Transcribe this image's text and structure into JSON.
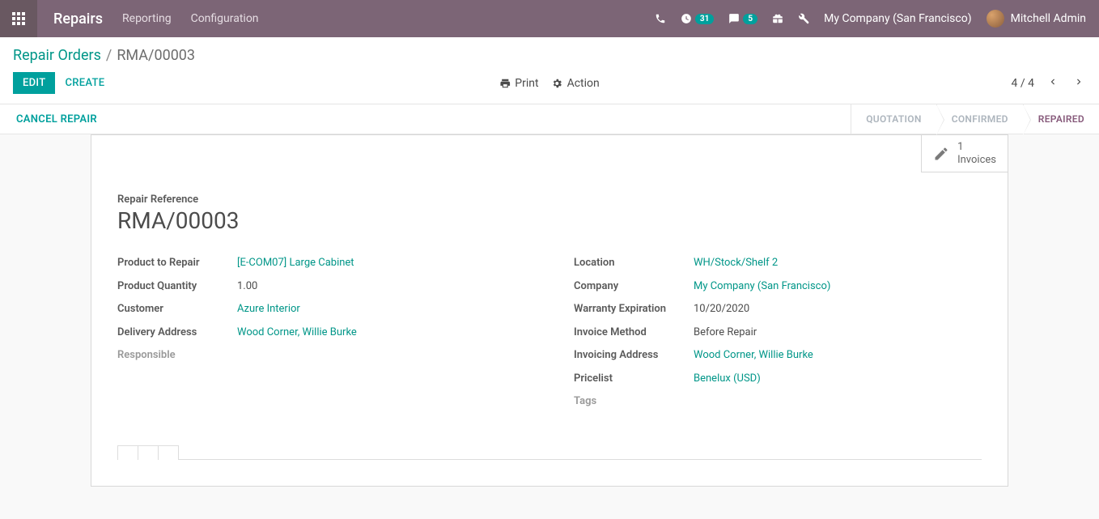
{
  "nav": {
    "app_name": "Repairs",
    "menu": [
      "Reporting",
      "Configuration"
    ],
    "activity_badge": "31",
    "discuss_badge": "5",
    "company": "My Company (San Francisco)",
    "user": "Mitchell Admin"
  },
  "breadcrumb": {
    "root": "Repair Orders",
    "current": "RMA/00003"
  },
  "buttons": {
    "edit": "EDIT",
    "create": "CREATE",
    "print": "Print",
    "action": "Action",
    "cancel": "CANCEL REPAIR"
  },
  "pager": {
    "text": "4 / 4"
  },
  "status_steps": {
    "quotation": "QUOTATION",
    "confirmed": "CONFIRMED",
    "repaired": "REPAIRED"
  },
  "stat_button": {
    "count": "1",
    "label": "Invoices"
  },
  "record": {
    "ref_label": "Repair Reference",
    "ref": "RMA/00003",
    "left": {
      "product_label": "Product to Repair",
      "product": "[E-COM07] Large Cabinet",
      "qty_label": "Product Quantity",
      "qty": "1.00",
      "customer_label": "Customer",
      "customer": "Azure Interior",
      "delivery_label": "Delivery Address",
      "delivery": "Wood Corner, Willie Burke",
      "responsible_label": "Responsible",
      "responsible": ""
    },
    "right": {
      "location_label": "Location",
      "location": "WH/Stock/Shelf 2",
      "company_label": "Company",
      "company": "My Company (San Francisco)",
      "warranty_label": "Warranty Expiration",
      "warranty": "10/20/2020",
      "invoice_method_label": "Invoice Method",
      "invoice_method": "Before Repair",
      "invoicing_addr_label": "Invoicing Address",
      "invoicing_addr": "Wood Corner, Willie Burke",
      "pricelist_label": "Pricelist",
      "pricelist": "Benelux (USD)",
      "tags_label": "Tags",
      "tags": ""
    }
  }
}
